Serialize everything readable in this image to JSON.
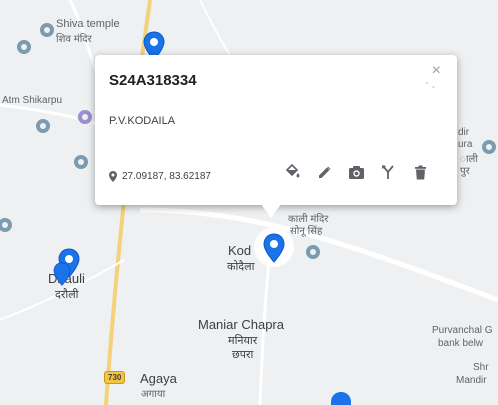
{
  "map": {
    "labels": {
      "shiva_temple_en": "Shiva temple",
      "shiva_temple_hi": "शिव मंदिर",
      "atm": "Atm Shikarpu",
      "dhauli_en": "Dhauli",
      "dhauli_hi": "दरौली",
      "kodaila_en": "Kod",
      "kodaila_hi": "कोदैला",
      "kali_mandir_1": "काली मंदिर",
      "kali_mandir_2": "सोनू सिंह",
      "maniar_en": "Maniar Chapra",
      "maniar_hi1": "मनियार",
      "maniar_hi2": "छपरा",
      "agaya_en": "Agaya",
      "agaya_hi": "अगाया",
      "purvanchal_1": "Purvanchal G",
      "purvanchal_2": "bank belw",
      "right_1": "dir",
      "right_2": "ura",
      "right_3": "ाली",
      "right_4": "पुर",
      "shri_1": "Shr",
      "shri_2": "Mandir",
      "highway": "730"
    }
  },
  "popup": {
    "title": "S24A318334",
    "subtitle": "P.V.KODAILA",
    "coordinates": "27.09187, 83.62187",
    "close": "×",
    "scroll": "⌃⌄"
  }
}
